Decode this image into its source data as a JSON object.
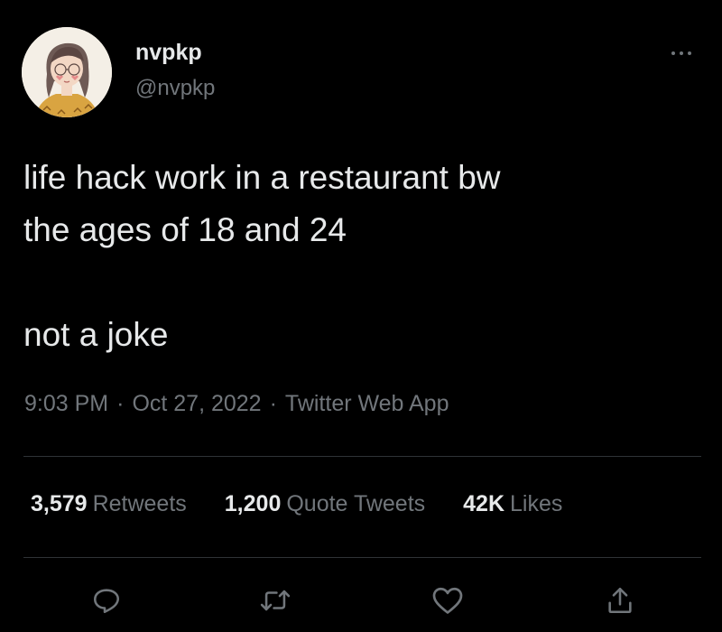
{
  "author": {
    "display_name": "nvpkp",
    "handle": "@nvpkp"
  },
  "tweet": {
    "lines": [
      "life hack work in a restaurant bw",
      "the ages of 18 and 24",
      "not a joke"
    ]
  },
  "meta": {
    "time": "9:03 PM",
    "separator": "·",
    "date": "Oct 27, 2022",
    "source": "Twitter Web App"
  },
  "stats": {
    "retweets": {
      "count": "3,579",
      "label": "Retweets"
    },
    "quotes": {
      "count": "1,200",
      "label": "Quote Tweets"
    },
    "likes": {
      "count": "42K",
      "label": "Likes"
    }
  },
  "icons": {
    "more": "more-horizontal-icon",
    "reply": "reply-icon",
    "retweet": "retweet-icon",
    "like": "heart-icon",
    "share": "share-icon"
  },
  "colors": {
    "background": "#000000",
    "text": "#e7e9ea",
    "secondary": "#71767b",
    "divider": "#2f3336"
  }
}
